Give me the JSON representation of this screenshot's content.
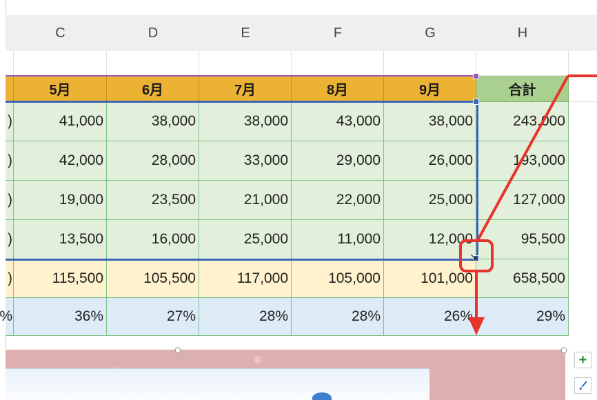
{
  "columns": [
    "C",
    "D",
    "E",
    "F",
    "G",
    "H"
  ],
  "header_row": {
    "partial_label": "",
    "months": [
      "5月",
      "6月",
      "7月",
      "8月",
      "9月"
    ],
    "total_label": "合計"
  },
  "data_rows": [
    {
      "partial": ")",
      "values": [
        "41,000",
        "38,000",
        "38,000",
        "43,000",
        "38,000"
      ],
      "total": "243,000"
    },
    {
      "partial": ")",
      "values": [
        "42,000",
        "28,000",
        "33,000",
        "29,000",
        "26,000"
      ],
      "total": "193,000"
    },
    {
      "partial": ")",
      "values": [
        "19,000",
        "23,500",
        "21,000",
        "22,000",
        "25,000"
      ],
      "total": "127,000"
    },
    {
      "partial": ")",
      "values": [
        "13,500",
        "16,000",
        "25,000",
        "11,000",
        "12,000"
      ],
      "total": "95,500"
    }
  ],
  "sum_row": {
    "partial": ")",
    "values": [
      "115,500",
      "105,500",
      "117,000",
      "105,000",
      "101,000"
    ],
    "total": "658,500"
  },
  "ratio_row": {
    "partial": "%",
    "values": [
      "36%",
      "27%",
      "28%",
      "28%",
      "26%"
    ],
    "total": "29%"
  },
  "side_buttons": {
    "add_icon": "plus-icon",
    "style_icon": "brush-icon"
  },
  "cursor_icon": "fill-handle-cursor-icon",
  "colors": {
    "header_orange": "#ecb234",
    "total_header_green": "#a9d08e",
    "data_green": "#e2efda",
    "sum_yellow": "#fff2cc",
    "ratio_blue": "#ddebf7",
    "selection_blue": "#3b66b8",
    "annotation_red": "#e8332c"
  }
}
